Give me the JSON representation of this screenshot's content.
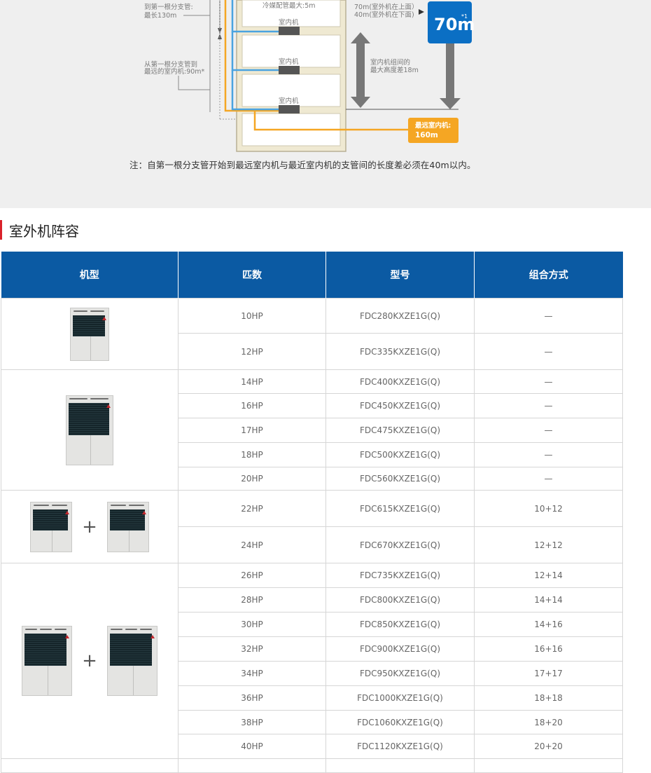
{
  "diagram": {
    "label_left_1_line1": "到第一根分支管:",
    "label_left_1_line2": "最长130m",
    "label_left_2_line1": "从第一根分支管到",
    "label_left_2_line2": "最远的室内机:90m*",
    "pipe_max": "冷媒配管最大:5m",
    "indoor_unit": "室内机",
    "height_line1": "70m(室外机在上面）",
    "height_line2": "40m(室外机在下面)",
    "badge_value": "70m",
    "badge_sup": "*1",
    "indoor_height_line1": "室内机组间的",
    "indoor_height_line2": "最大高度差18m",
    "farthest_label": "最远室内机:",
    "farthest_value": "160m",
    "note": "注：自第一根分支管开始到最远室内机与最近室内机的支管间的长度差必须在40m以内。",
    "accent_orange": "#f5a623",
    "accent_blue": "#0b6fc4"
  },
  "section": {
    "title": "室外机阵容",
    "accent": "#d9222a"
  },
  "table": {
    "headers": [
      "机型",
      "匹数",
      "型号",
      "组合方式"
    ],
    "header_color": "#0b5aa3",
    "groups": [
      {
        "image": "single-outdoor-unit-small",
        "rows": [
          {
            "hp": "10HP",
            "model": "FDC280KXZE1G(Q)",
            "combo": "—"
          },
          {
            "hp": "12HP",
            "model": "FDC335KXZE1G(Q)",
            "combo": "—"
          }
        ]
      },
      {
        "image": "single-outdoor-unit-large",
        "rows": [
          {
            "hp": "14HP",
            "model": "FDC400KXZE1G(Q)",
            "combo": "—"
          },
          {
            "hp": "16HP",
            "model": "FDC450KXZE1G(Q)",
            "combo": "—"
          },
          {
            "hp": "17HP",
            "model": "FDC475KXZE1G(Q)",
            "combo": "—"
          },
          {
            "hp": "18HP",
            "model": "FDC500KXZE1G(Q)",
            "combo": "—"
          },
          {
            "hp": "20HP",
            "model": "FDC560KXZE1G(Q)",
            "combo": "—"
          }
        ]
      },
      {
        "image": "double-outdoor-unit-small",
        "plus": "+",
        "rows": [
          {
            "hp": "22HP",
            "model": "FDC615KXZE1G(Q)",
            "combo": "10+12"
          },
          {
            "hp": "24HP",
            "model": "FDC670KXZE1G(Q)",
            "combo": "12+12"
          }
        ]
      },
      {
        "image": "double-outdoor-unit-large",
        "plus": "+",
        "rows": [
          {
            "hp": "26HP",
            "model": "FDC735KXZE1G(Q)",
            "combo": "12+14"
          },
          {
            "hp": "28HP",
            "model": "FDC800KXZE1G(Q)",
            "combo": "14+14"
          },
          {
            "hp": "30HP",
            "model": "FDC850KXZE1G(Q)",
            "combo": "14+16"
          },
          {
            "hp": "32HP",
            "model": "FDC900KXZE1G(Q)",
            "combo": "16+16"
          },
          {
            "hp": "34HP",
            "model": "FDC950KXZE1G(Q)",
            "combo": "17+17"
          },
          {
            "hp": "36HP",
            "model": "FDC1000KXZE1G(Q)",
            "combo": "18+18"
          },
          {
            "hp": "38HP",
            "model": "FDC1060KXZE1G(Q)",
            "combo": "18+20"
          },
          {
            "hp": "40HP",
            "model": "FDC1120KXZE1G(Q)",
            "combo": "20+20"
          }
        ]
      }
    ]
  }
}
